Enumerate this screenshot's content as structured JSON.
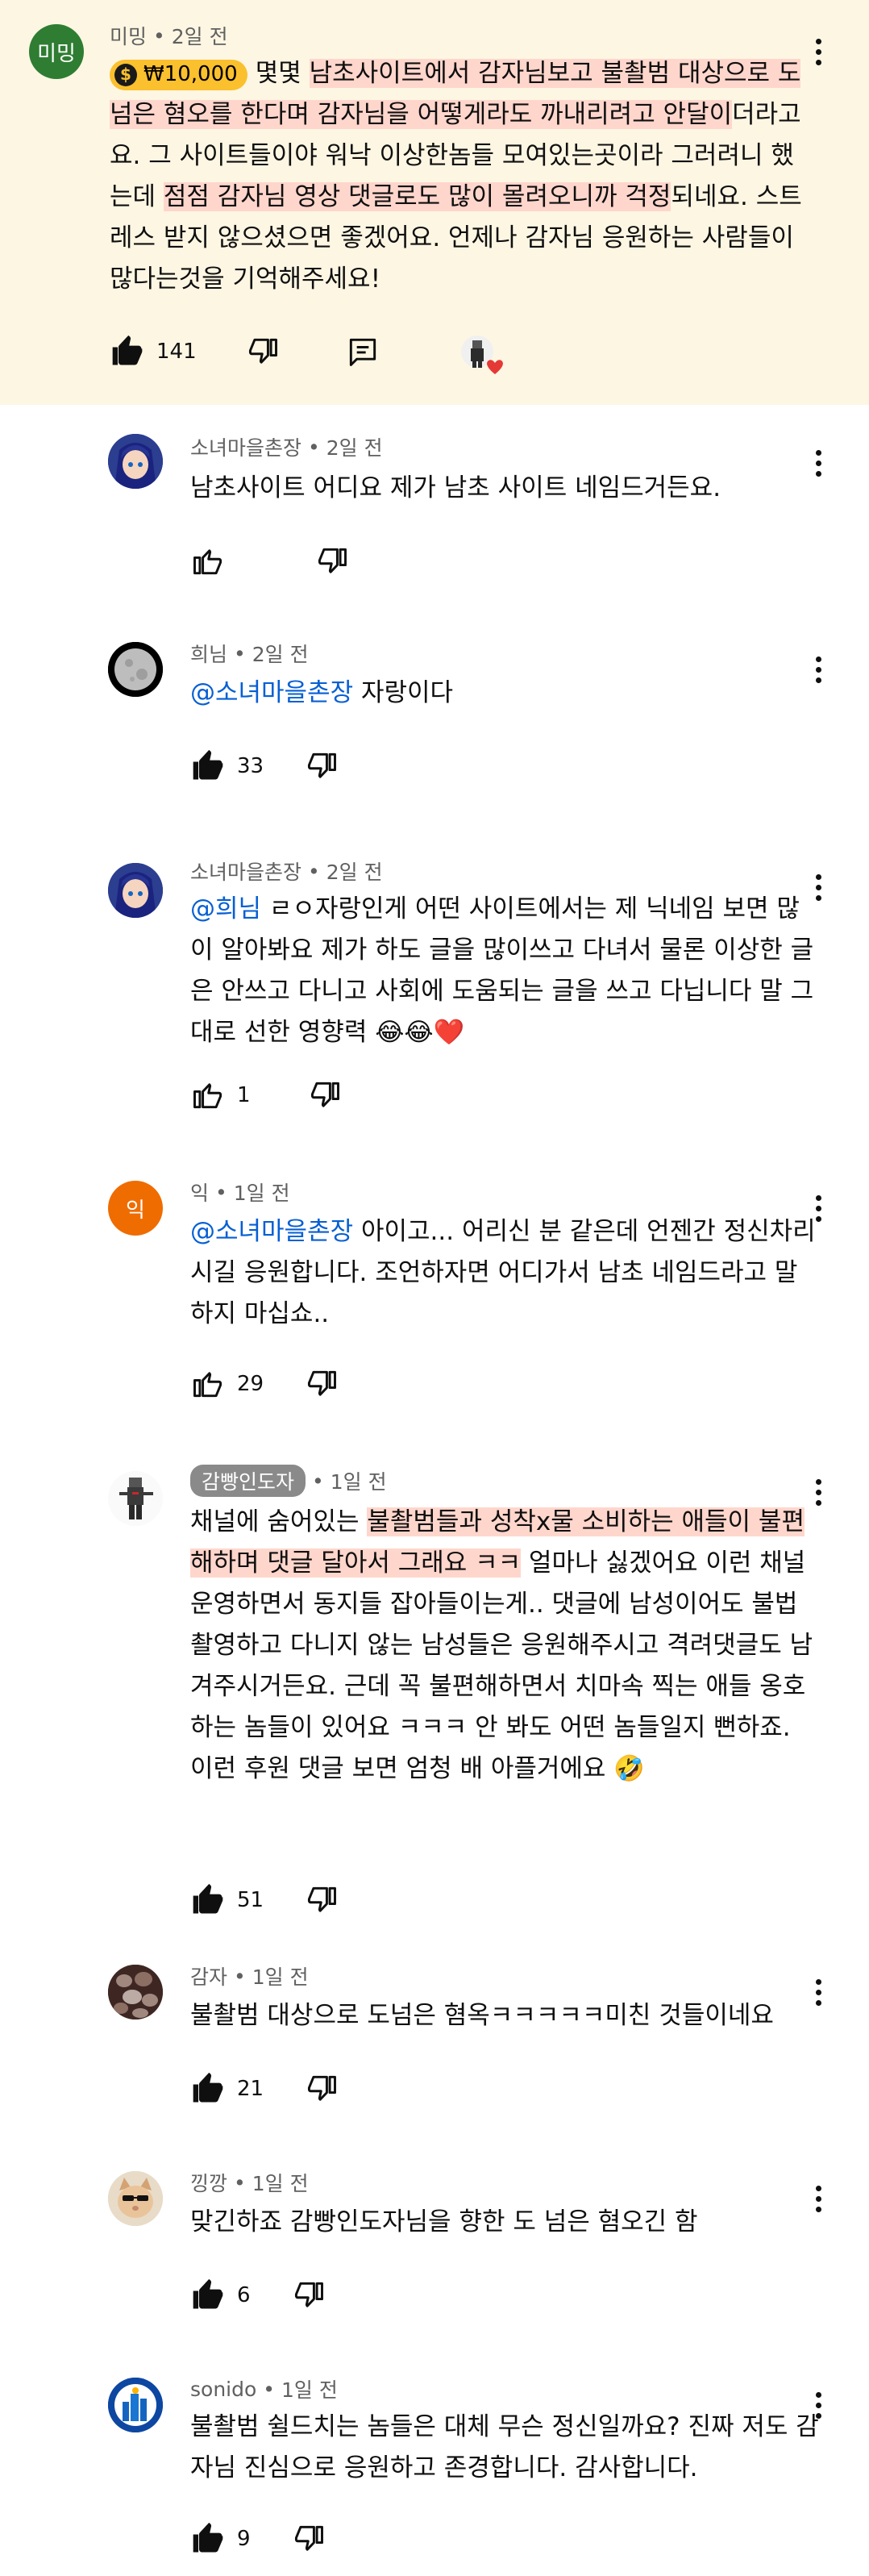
{
  "colors": {
    "highlight_bg": "#fdf6e3",
    "mention": "#065fd4",
    "text_highlight": "#ffd6cc",
    "donation": "#fbc02d"
  },
  "top_comment": {
    "avatar_text": "미밍",
    "avatar_color": "#2e7d32",
    "author": "미밍",
    "time": "2일 전",
    "donation": "₩10,000",
    "text": {
      "p1": "몇몇 ",
      "h1": "남초사이트에서 감자님보고 불촬범 대상으로 도 넘은 혐오를 한다며 감자님을 어떻게라도 까내리려고 안달이",
      "p2": "더라고요. 그 사이트들이야 워낙 이상한놈들 모여있는곳이라 그러려니 했는데 ",
      "h2": "점점 감자님 영상 댓글로도 많이 몰려오니까 걱정",
      "p3": "되네요. 스트레스 받지 않으셨으면 좋겠어요. 언제나 감자님 응원하는 사람들이 많다는것을 기억해주세요!"
    },
    "likes": "141",
    "like_icon": "thumbs-up-filled",
    "reply_icon": "comment-icon",
    "creator_heart": "heart"
  },
  "replies": [
    {
      "author": "소녀마을촌장",
      "time": "2일 전",
      "text": "남초사이트 어디요 제가 남초 사이트 네임드거든요.",
      "likes": "",
      "liked": false,
      "avatar_kind": "anime"
    },
    {
      "author": "희님",
      "time": "2일 전",
      "mention": "@소녀마을촌장",
      "text": " 자랑이다",
      "likes": "33",
      "liked": true,
      "avatar_kind": "moon"
    },
    {
      "author": "소녀마을촌장",
      "time": "2일 전",
      "mention": "@희님",
      "text": " ㄹㅇ자랑인게 어떤 사이트에서는 제 닉네임 보면 많이 알아봐요 제가 하도 글을 많이쓰고 다녀서 물론 이상한 글은 안쓰고 다니고 사회에 도움되는 글을 쓰고 다닙니다 말 그대로 선한 영향력 😂😂❤️",
      "likes": "1",
      "liked": false,
      "avatar_kind": "anime"
    },
    {
      "author": "익",
      "time": "1일 전",
      "avatar_text": "익",
      "mention": "@소녀마을촌장",
      "text": " 아이고... 어리신 분 같은데 언젠간 정신차리시길 응원합니다. 조언하자면 어디가서 남초 네임드라고 말하지 마십쇼..",
      "likes": "29",
      "liked": false,
      "avatar_kind": "letter"
    },
    {
      "author": "감빵인도자",
      "time": "1일 전",
      "creator": true,
      "text_p1": "채널에 숨어있는 ",
      "text_h1": "불촬범들과 성착x물 소비하는 애들이 불편해하며 댓글 달아서 그래요 ㅋㅋ",
      "text_p2": " 얼마나 싫겠어요 이런 채널 운영하면서 동지들 잡아들이는게.. 댓글에 남성이어도 불법촬영하고 다니지 않는 남성들은 응원해주시고 격려댓글도 남겨주시거든요. 근데 꼭 불편해하면서 치마속 찍는 애들 옹호하는 놈들이 있어요 ㅋㅋㅋ 안 봐도 어떤 놈들일지 뻔하죠. 이런 후원 댓글 보면 엄청 배 아플거에요 🤣",
      "likes": "51",
      "liked": true,
      "avatar_kind": "soldier"
    },
    {
      "author": "감자",
      "time": "1일 전",
      "text": "불촬범 대상으로 도넘은 혐옥ㅋㅋㅋㅋㅋ미친 것들이네요",
      "likes": "21",
      "liked": true,
      "avatar_kind": "potato"
    },
    {
      "author": "낑깡",
      "time": "1일 전",
      "text": "맞긴하죠 감빵인도자님을 향한 도 넘은 혐오긴 함",
      "likes": "6",
      "liked": true,
      "avatar_kind": "cat"
    },
    {
      "author": "sonido",
      "time": "1일 전",
      "text": "불촬범 쉴드치는 놈들은 대체 무슨 정신일까요? 진짜 저도 감자님 진심으로 응원하고 존경합니다. 감사합니다.",
      "likes": "9",
      "liked": true,
      "avatar_kind": "city"
    }
  ]
}
